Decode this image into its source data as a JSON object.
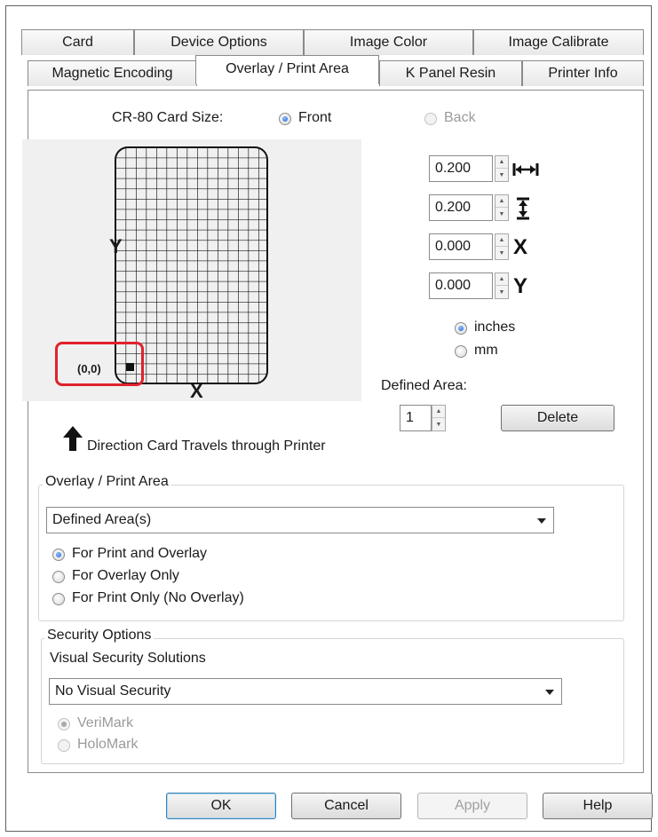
{
  "tabs": {
    "row_back": [
      "Card",
      "Device Options",
      "Image Color",
      "Image Calibrate"
    ],
    "row_front": [
      "Magnetic Encoding",
      "Overlay / Print Area",
      "K Panel Resin",
      "Printer Info"
    ],
    "active": "Overlay / Print Area"
  },
  "card_size": {
    "label": "CR-80 Card Size:",
    "front": "Front",
    "back": "Back",
    "selected": "Front"
  },
  "preview": {
    "y_axis": "Y",
    "x_axis": "X",
    "origin": "(0,0)"
  },
  "dimensions": {
    "width": "0.200",
    "height": "0.200",
    "x": "0.000",
    "y": "0.000",
    "x_label": "X",
    "y_label": "Y",
    "width_icon": "horizontal-extent-icon",
    "height_icon": "vertical-extent-icon"
  },
  "units": {
    "inches": "inches",
    "mm": "mm",
    "selected": "inches"
  },
  "defined_area": {
    "label": "Defined Area:",
    "value": "1",
    "delete": "Delete"
  },
  "direction": {
    "icon": "up-arrow-icon",
    "text": "Direction Card Travels through Printer"
  },
  "overlay_area": {
    "title": "Overlay / Print Area",
    "selected": "Defined Area(s)",
    "options": [
      "For Print and Overlay",
      "For Overlay Only",
      "For Print Only (No Overlay)"
    ],
    "checked": "For Print and Overlay"
  },
  "security": {
    "title": "Security Options",
    "subtitle": "Visual Security Solutions",
    "selected": "No Visual Security",
    "options": [
      "VeriMark",
      "HoloMark"
    ],
    "checked": "VeriMark"
  },
  "buttons": {
    "ok": "OK",
    "cancel": "Cancel",
    "apply": "Apply",
    "help": "Help"
  },
  "colors": {
    "highlight": "#e0222b",
    "preview_bg": "#f0f0f0",
    "radio_selected": "#1f5fd0"
  }
}
